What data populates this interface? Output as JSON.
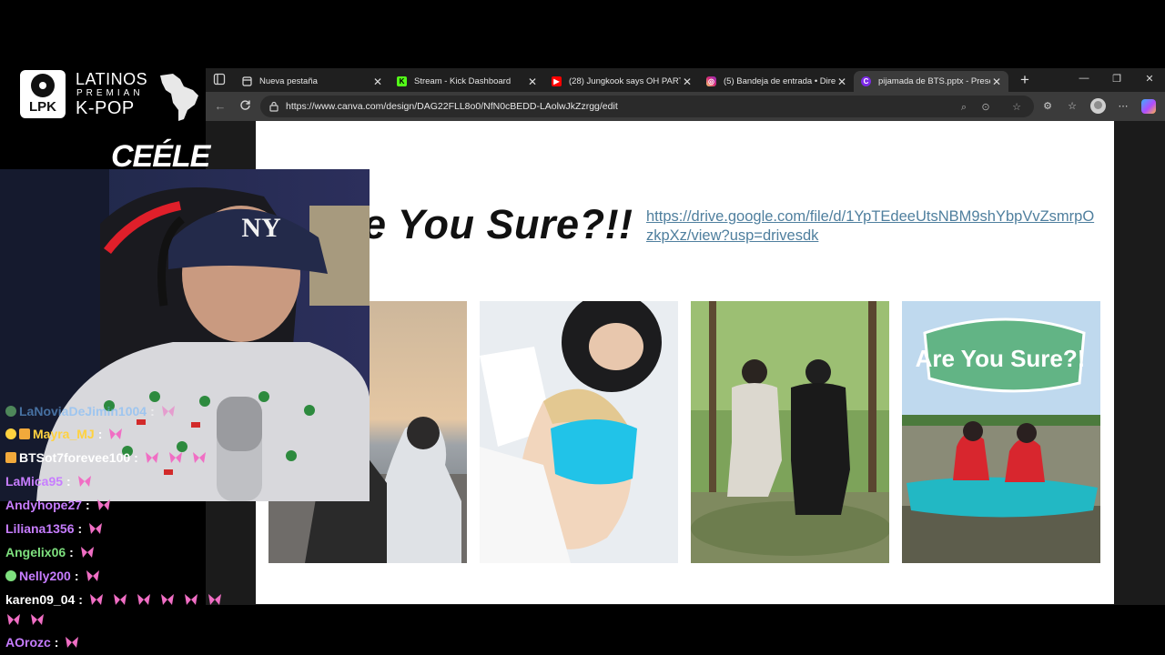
{
  "overlay": {
    "logo": {
      "mark": "LPK",
      "line1": "LATINOS",
      "line2": "PREMIAN",
      "line3": "K-POP"
    },
    "streamer_name": "CEÉLE"
  },
  "browser": {
    "tabs": [
      {
        "title": "Nueva pestaña",
        "icon": "page-icon",
        "active": false
      },
      {
        "title": "Stream - Kick Dashboard",
        "icon": "kick-icon",
        "active": false
      },
      {
        "title": "(28) Jungkook says OH PARTY",
        "icon": "youtube-icon",
        "active": false
      },
      {
        "title": "(5) Bandeja de entrada • Direc",
        "icon": "instagram-icon",
        "active": false
      },
      {
        "title": "pijamada de BTS.pptx - Presen",
        "icon": "canva-icon",
        "active": true
      }
    ],
    "url": "https://www.canva.com/design/DAG22FLL8o0/NfN0cBEDD-LAolwJkZzrgg/edit"
  },
  "slide": {
    "title": "e You Sure?!!",
    "link": "https://drive.google.com/file/d/1YpTEdeeUtsNBM9shYbpVvZsmrpOzkpXz/view?usp=drivesdk",
    "poster_text": "Are You Sure?!"
  },
  "chat": [
    {
      "user": "LaNoviaDeJimin1004",
      "badges": [
        "gift"
      ],
      "color": "#6fb7ff",
      "emotes": 1
    },
    {
      "user": "Mayra_MJ",
      "badges": [
        "sub",
        "crown"
      ],
      "color": "#ffd23f",
      "emotes": 1
    },
    {
      "user": "BTSot7forevee100",
      "badges": [
        "crown"
      ],
      "color": "#ffffff",
      "emotes": 3
    },
    {
      "user": "LaMica95",
      "badges": [],
      "color": "#c77dff",
      "emotes": 1
    },
    {
      "user": "Andyhope27",
      "badges": [],
      "color": "#c77dff",
      "emotes": 1
    },
    {
      "user": "Liliana1356",
      "badges": [],
      "color": "#c77dff",
      "emotes": 1
    },
    {
      "user": "Angelix06",
      "badges": [],
      "color": "#7ee07e",
      "emotes": 1
    },
    {
      "user": "Nelly200",
      "badges": [
        "gift"
      ],
      "color": "#c77dff",
      "emotes": 1
    },
    {
      "user": "karen09_04",
      "badges": [],
      "color": "#ffffff",
      "emotes": 8
    },
    {
      "user": "AOrozc",
      "badges": [],
      "color": "#c77dff",
      "emotes": 1
    }
  ],
  "colors": {
    "link": "#4f7f9e",
    "accent_kick": "#53fc18",
    "bow": "#f06ec4"
  }
}
